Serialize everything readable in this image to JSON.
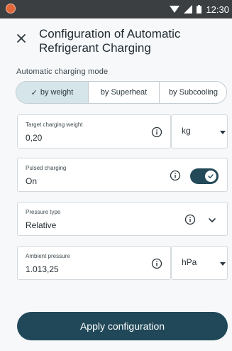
{
  "status_bar": {
    "time": "12:30"
  },
  "header": {
    "title": "Configuration of Automatic Refrigerant Charging",
    "close_icon": "close-icon"
  },
  "charging_mode": {
    "label": "Automatic charging mode",
    "options": [
      {
        "label": "by weight",
        "selected": true
      },
      {
        "label": "by Superheat",
        "selected": false
      },
      {
        "label": "by Subcooling",
        "selected": false
      }
    ]
  },
  "fields": {
    "target_weight": {
      "label": "Target charging weight",
      "value": "0,20",
      "unit": "kg"
    },
    "pulsed_charging": {
      "label": "Pulsed charging",
      "value": "On",
      "toggle_on": true
    },
    "pressure_type": {
      "label": "Pressure type",
      "value": "Relative"
    },
    "ambient_pressure": {
      "label": "Ambient pressure",
      "value": "1.013,25",
      "unit": "hPa"
    }
  },
  "apply_button": {
    "label": "Apply configuration"
  },
  "colors": {
    "accent": "#204859",
    "selected_segment": "#d5e5ea",
    "background": "#f6f8fa"
  }
}
